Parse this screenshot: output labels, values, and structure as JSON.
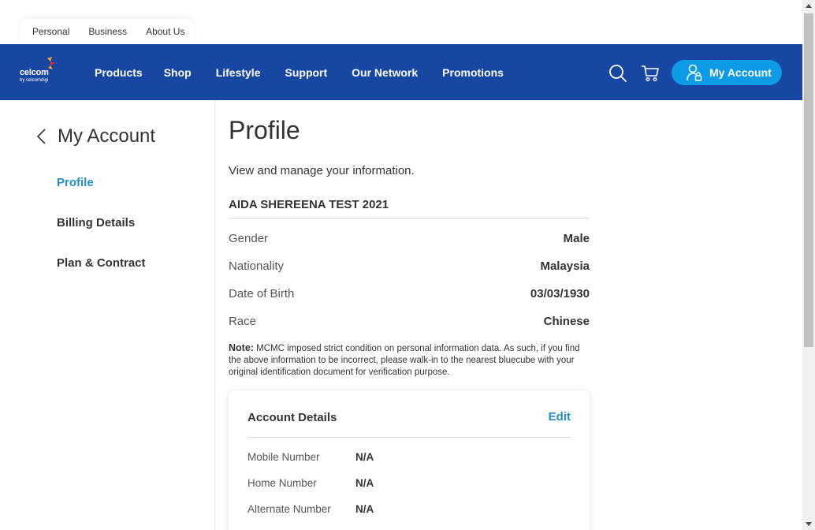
{
  "segments": [
    "Personal",
    "Business",
    "About Us"
  ],
  "brand": {
    "name": "celcom",
    "by": "by celcomdigi"
  },
  "nav": {
    "links": [
      "Products",
      "Shop",
      "Lifestyle",
      "Support",
      "Our Network",
      "Promotions"
    ],
    "account_label": "My Account",
    "icons": [
      "search-icon",
      "cart-icon",
      "user-lock-icon"
    ],
    "bg_color": "#1846a3",
    "account_color": "#0d9be6"
  },
  "sidebar": {
    "title": "My Account",
    "items": [
      {
        "label": "Profile",
        "active": true
      },
      {
        "label": "Billing Details",
        "active": false
      },
      {
        "label": "Plan & Contract",
        "active": false
      }
    ],
    "active_color": "#1e8fc9"
  },
  "profile": {
    "title": "Profile",
    "subtitle": "View and manage your information.",
    "name": "AIDA SHEREENA TEST 2021",
    "fields": [
      {
        "label": "Gender",
        "value": "Male"
      },
      {
        "label": "Nationality",
        "value": "Malaysia"
      },
      {
        "label": "Date of Birth",
        "value": "03/03/1930"
      },
      {
        "label": "Race",
        "value": "Chinese"
      }
    ],
    "note_label": "Note:",
    "note_text": "MCMC imposed strict condition on personal information data. As such, if you find the above information to be incorrect, please walk-in to the nearest bluecube with your original identification document for verification purpose."
  },
  "account_details": {
    "title": "Account Details",
    "edit_label": "Edit",
    "rows": [
      {
        "label": "Mobile Number",
        "value": "N/A"
      },
      {
        "label": "Home Number",
        "value": "N/A"
      },
      {
        "label": "Alternate Number",
        "value": "N/A"
      }
    ]
  }
}
